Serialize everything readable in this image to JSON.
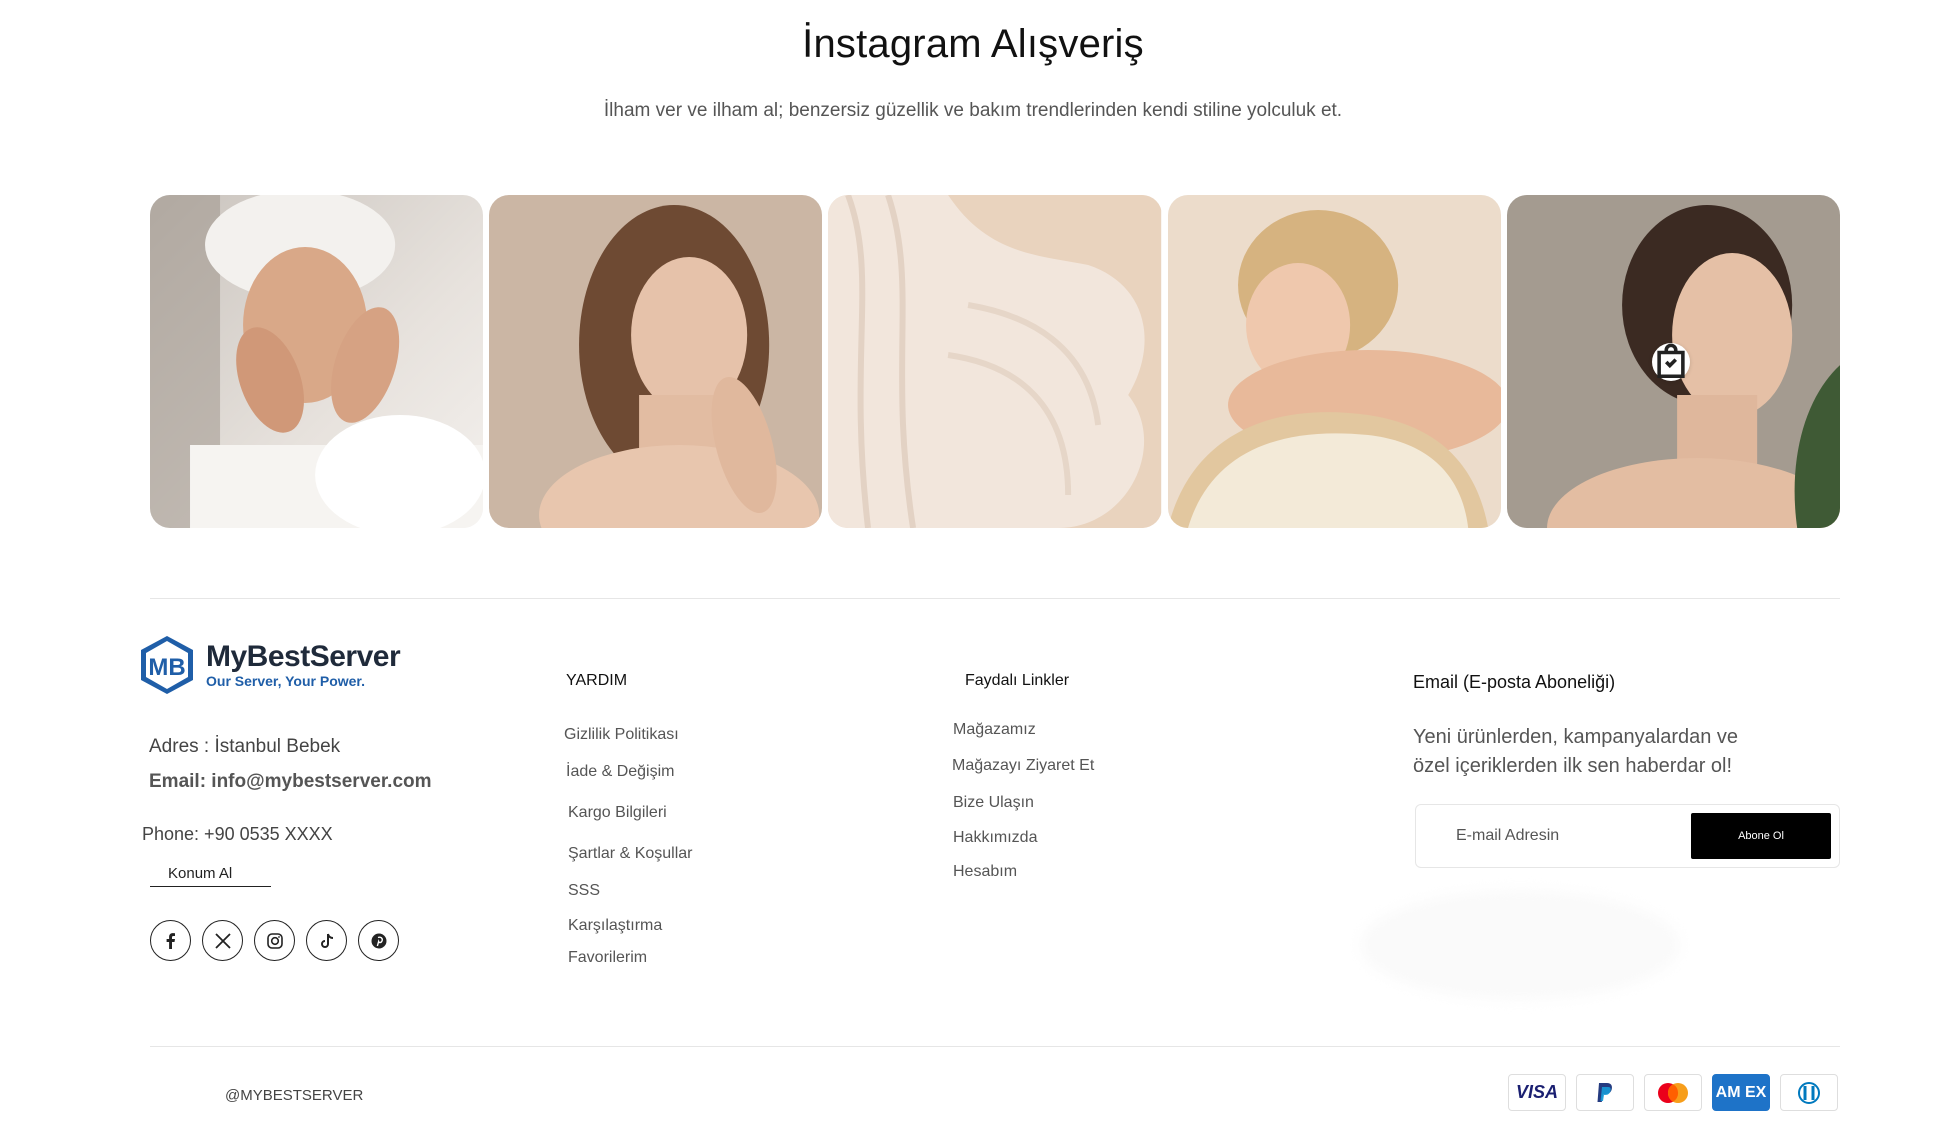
{
  "instagram": {
    "title": "İnstagram Alışveriş",
    "subtitle": "İlham ver ve ilham al; benzersiz güzellik ve bakım trendlerinden kendi stiline yolculuk et."
  },
  "brand": {
    "name": "MyBestServer",
    "tagline": "Our Server, Your Power.",
    "logo_mark": "MB",
    "color": "#1f5ea8"
  },
  "contact": {
    "address": "Adres : İstanbul Bebek",
    "email": "Email: info@mybestserver.com",
    "phone": "Phone: +90 0535 XXXX",
    "location_link": "Konum Al"
  },
  "socials": [
    "facebook-icon",
    "x-icon",
    "instagram-icon",
    "tiktok-icon",
    "pinterest-icon"
  ],
  "help": {
    "heading": "YARDIM",
    "links": [
      "Gizlilik Politikası",
      "İade & Değişim",
      "Kargo Bilgileri",
      "Şartlar & Koşullar",
      "SSS",
      "Karşılaştırma",
      "Favorilerim"
    ]
  },
  "useful": {
    "heading": "Faydalı Linkler",
    "links": [
      "Mağazamız",
      "Mağazayı Ziyaret Et",
      "Bize Ulaşın",
      "Hakkımızda",
      "Hesabım"
    ]
  },
  "newsletter": {
    "heading": "Email (E-posta Aboneliği)",
    "text": "Yeni ürünlerden, kampanyalardan ve özel içeriklerden ilk sen haberdar ol!",
    "placeholder": "E-mail Adresin",
    "button": "Abone Ol"
  },
  "footer": {
    "copyright": "@MYBESTSERVER",
    "payments": [
      "visa",
      "paypal",
      "mastercard",
      "amex",
      "diners"
    ],
    "visa_label": "VISA",
    "amex_label": "AM EX"
  }
}
